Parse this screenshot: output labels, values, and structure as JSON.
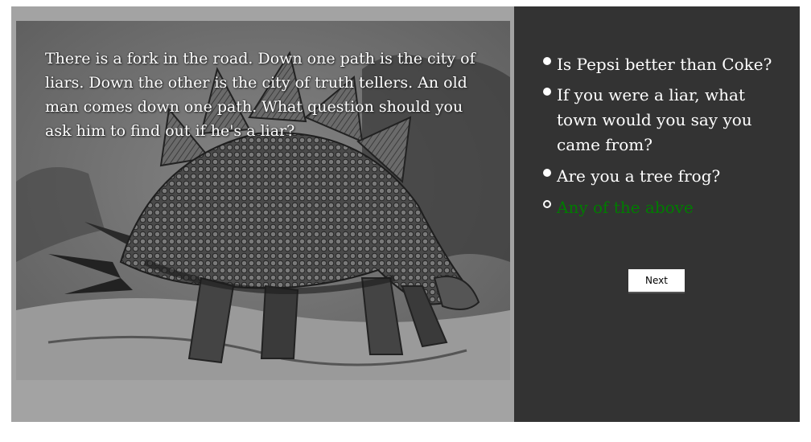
{
  "question": "There is a fork in the road. Down one path is the city of liars. Down the other is the city of truth tellers. An old man comes down one path. What question should you ask him to find out if he's a liar?",
  "illustration": {
    "subject": "stegosaurus sketch"
  },
  "options": [
    {
      "label": "Is Pepsi better than Coke?",
      "state": "filled"
    },
    {
      "label": "If you were a liar, what town would you say you came from?",
      "state": "filled"
    },
    {
      "label": "Are you a tree frog?",
      "state": "filled"
    },
    {
      "label": "Any of the above",
      "state": "selected"
    }
  ],
  "next_label": "Next",
  "colors": {
    "left_panel": "#a3a3a3",
    "right_panel": "#333333",
    "selected_option": "#007c00"
  }
}
